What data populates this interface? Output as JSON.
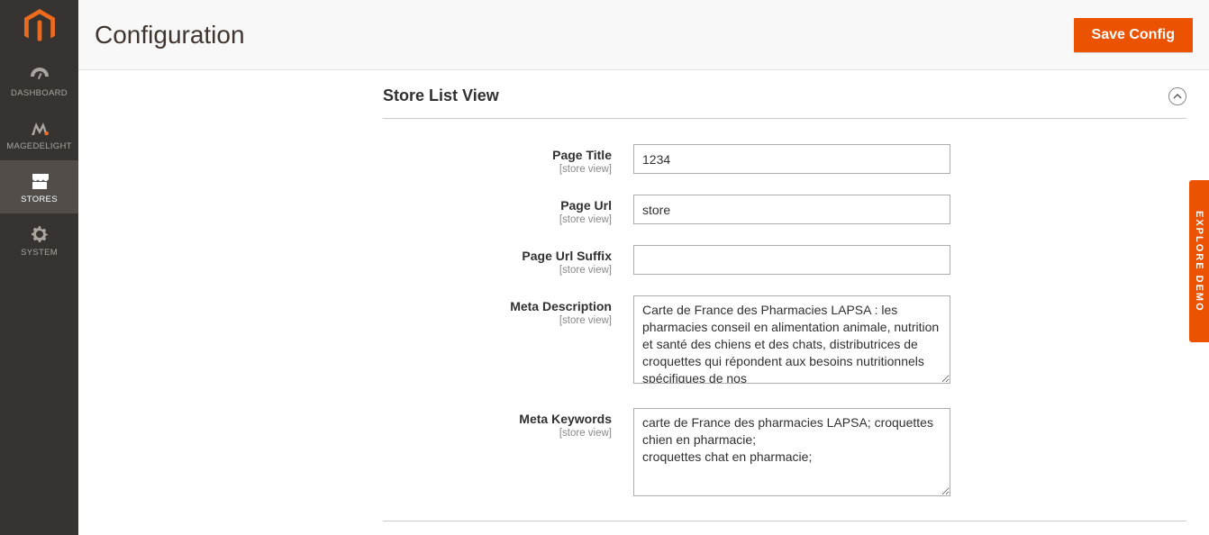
{
  "header": {
    "page_title": "Configuration",
    "save_button": "Save Config"
  },
  "sidebar": {
    "items": [
      {
        "label": "DASHBOARD"
      },
      {
        "label": "MAGEDELIGHT"
      },
      {
        "label": "STORES"
      },
      {
        "label": "SYSTEM"
      }
    ]
  },
  "section": {
    "title": "Store List View",
    "scope_label": "[store view]",
    "fields": {
      "page_title": {
        "label": "Page Title",
        "value": "1234"
      },
      "page_url": {
        "label": "Page Url",
        "value": "store"
      },
      "page_url_suffix": {
        "label": "Page Url Suffix",
        "value": ""
      },
      "meta_description": {
        "label": "Meta Description",
        "value": "Carte de France des Pharmacies LAPSA : les pharmacies conseil en alimentation animale, nutrition et santé des chiens et des chats, distributrices de croquettes qui répondent aux besoins nutritionnels spécifiques de nos"
      },
      "meta_keywords": {
        "label": "Meta Keywords",
        "value": "carte de France des pharmacies LAPSA; croquettes chien en pharmacie;\ncroquettes chat en pharmacie;"
      }
    }
  },
  "explore_tab": "EXPLORE DEMO"
}
